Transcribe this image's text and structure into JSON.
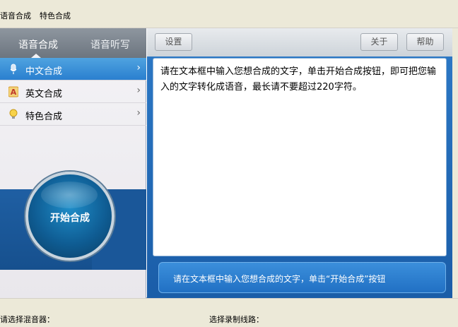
{
  "menubar": {
    "items": [
      "语音合成",
      "特色合成"
    ]
  },
  "sidebar": {
    "tabs": [
      {
        "label": "语音合成"
      },
      {
        "label": "语音听写"
      }
    ],
    "items": [
      {
        "label": "中文合成",
        "icon": "mic-icon"
      },
      {
        "label": "英文合成",
        "icon": "letter-a-icon"
      },
      {
        "label": "特色合成",
        "icon": "bulb-icon"
      }
    ],
    "start_label": "开始合成"
  },
  "toolbar": {
    "settings": "设置",
    "about": "关于",
    "help": "帮助"
  },
  "textbox": {
    "text": "请在文本框中输入您想合成的文字，单击开始合成按钮，即可把您输入的文字转化成语音，最长请不要超过220字符。"
  },
  "hint": {
    "text": "请在文本框中输入您想合成的文字，单击“开始合成”按钮"
  },
  "status": {
    "mixer_label": "请选择混音器：",
    "record_label": "选择录制线路："
  },
  "colors": {
    "accent": "#2a7fcf",
    "panel_blue": "#1a5da8"
  }
}
